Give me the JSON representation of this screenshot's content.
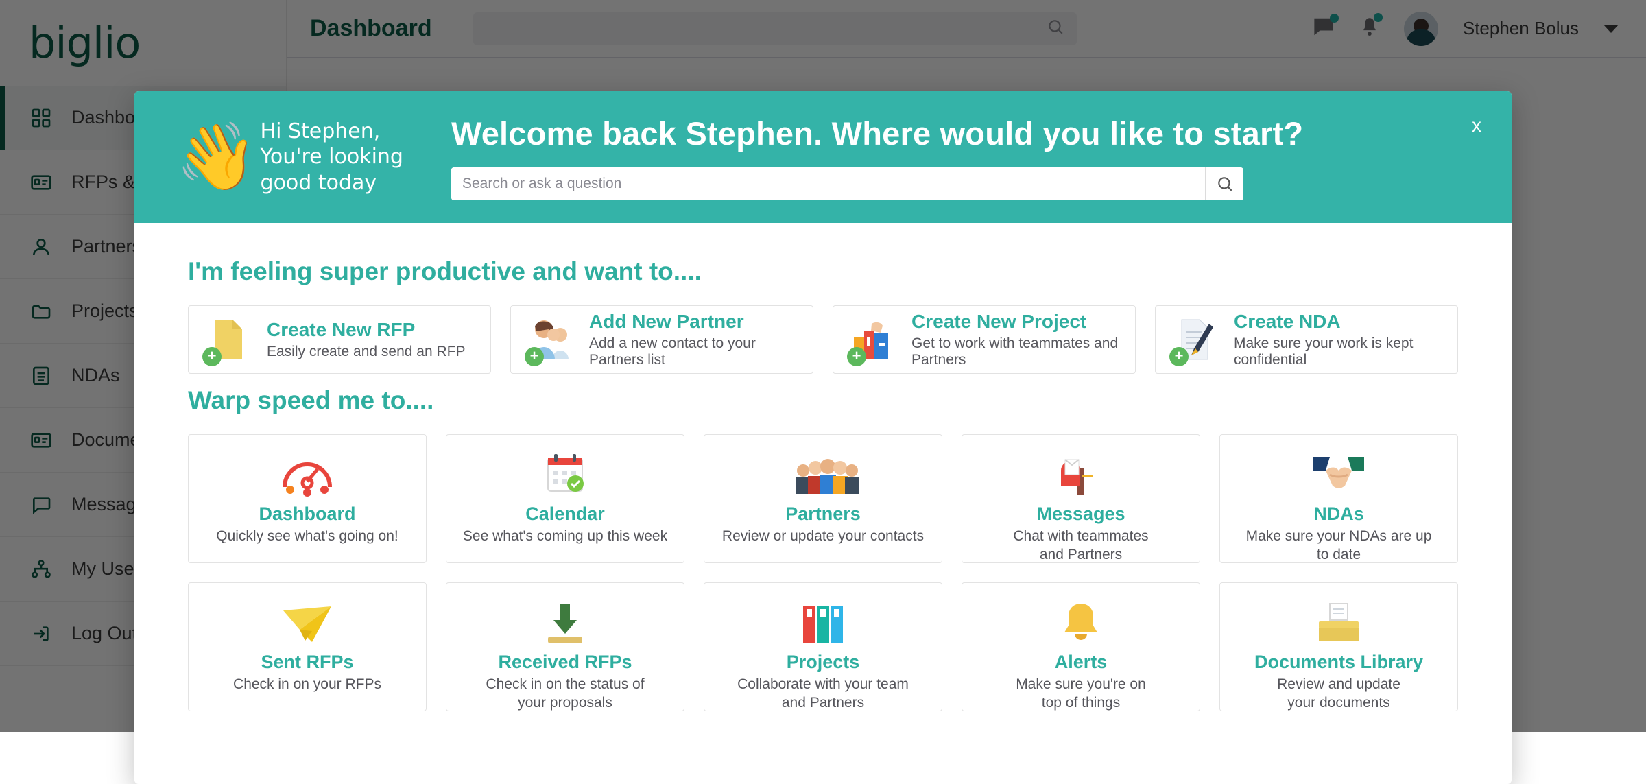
{
  "brand": {
    "name": "biglio"
  },
  "sidebar": {
    "items": [
      {
        "label": "Dashboard",
        "icon": "grid-icon",
        "active": true
      },
      {
        "label": "RFPs & Proposals",
        "icon": "card-icon",
        "active": false
      },
      {
        "label": "Partners",
        "icon": "person-icon",
        "active": false
      },
      {
        "label": "Projects",
        "icon": "folder-icon",
        "active": false
      },
      {
        "label": "NDAs",
        "icon": "document-icon",
        "active": false
      },
      {
        "label": "Documents",
        "icon": "card-icon",
        "active": false
      },
      {
        "label": "Messages",
        "icon": "chat-icon",
        "active": false
      },
      {
        "label": "My Users",
        "icon": "users-network-icon",
        "active": false
      },
      {
        "label": "Log Out",
        "icon": "logout-icon",
        "active": false
      }
    ]
  },
  "topbar": {
    "page_title": "Dashboard",
    "search_placeholder": "",
    "user_name": "Stephen Bolus",
    "messages_icon": "chat-icon",
    "alerts_icon": "bell-icon",
    "avatar": "avatar"
  },
  "modal": {
    "close_label": "x",
    "greeting_emoji": "waving-hand",
    "greeting_line1": "Hi Stephen,",
    "greeting_line2": "You're looking",
    "greeting_line3": "good today",
    "welcome_title": "Welcome back Stephen. Where would you like to start?",
    "search_placeholder": "Search or ask a question",
    "search_value": "",
    "search_button_icon": "search-icon",
    "productive_heading": "I'm feeling super productive and want to....",
    "warp_heading": "Warp speed me to....",
    "actions": [
      {
        "title": "Create New RFP",
        "sub": "Easily create and send an RFP",
        "icon": "document-add-icon"
      },
      {
        "title": "Add New Partner",
        "sub": "Add a new contact to your Partners list",
        "icon": "people-add-icon"
      },
      {
        "title": "Create New Project",
        "sub": "Get to work with teammates and Partners",
        "icon": "binders-add-icon"
      },
      {
        "title": "Create NDA",
        "sub": "Make sure your work is kept confidential",
        "icon": "contract-pen-icon"
      }
    ],
    "tiles_row1": [
      {
        "title": "Dashboard",
        "sub": "Quickly see what's going on!",
        "icon": "gauge-icon"
      },
      {
        "title": "Calendar",
        "sub": "See what's coming up this week",
        "icon": "calendar-check-icon"
      },
      {
        "title": "Partners",
        "sub": "Review or update your contacts",
        "icon": "people-group-icon"
      },
      {
        "title": "Messages",
        "sub": "Chat with teammates\nand Partners",
        "icon": "mailbox-icon"
      },
      {
        "title": "NDAs",
        "sub": "Make sure your NDAs are up\nto date",
        "icon": "handshake-icon"
      }
    ],
    "tiles_row2": [
      {
        "title": "Sent RFPs",
        "sub": "Check in on your RFPs",
        "icon": "paper-plane-icon"
      },
      {
        "title": "Received RFPs",
        "sub": "Check in on the status of\nyour proposals",
        "icon": "download-tray-icon"
      },
      {
        "title": "Projects",
        "sub": "Collaborate with your team\nand Partners",
        "icon": "binders-icon"
      },
      {
        "title": "Alerts",
        "sub": "Make sure you're on\ntop of things",
        "icon": "bell-icon"
      },
      {
        "title": "Documents Library",
        "sub": "Review and update\nyour documents",
        "icon": "file-tray-icon"
      }
    ]
  },
  "colors": {
    "brand_green": "#0d5c47",
    "teal": "#34b3a8",
    "tile_teal": "#2fae9f",
    "badge_green": "#5cb85c"
  }
}
